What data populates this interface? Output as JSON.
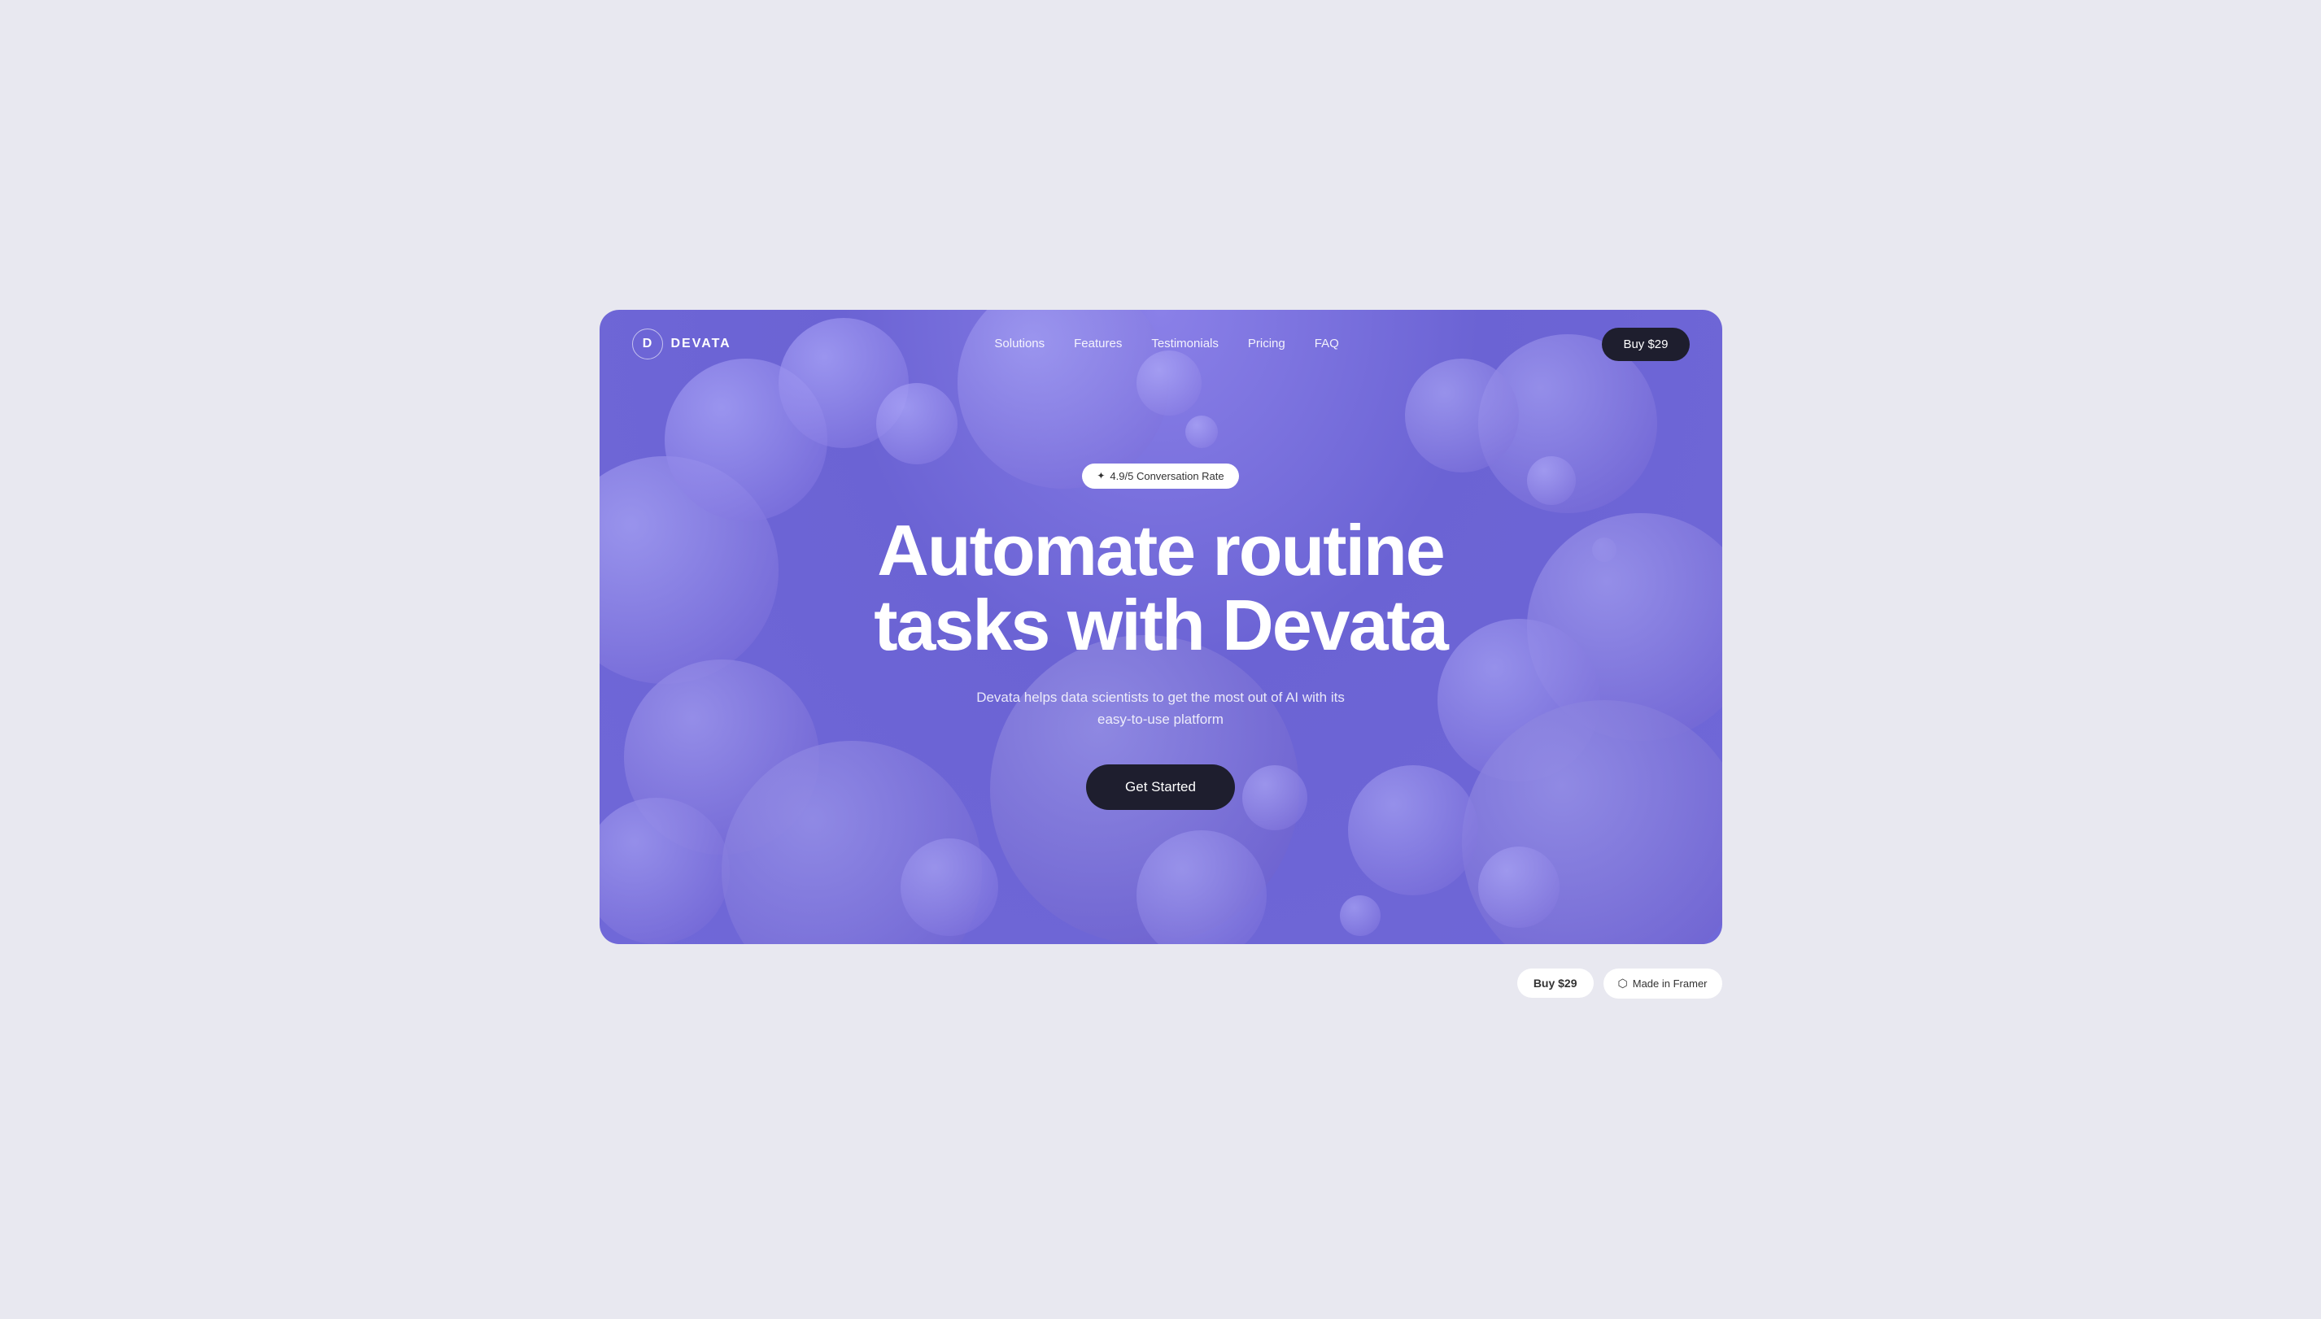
{
  "logo": {
    "letter": "D",
    "name": "DEVATA"
  },
  "nav": {
    "links": [
      {
        "label": "Solutions",
        "href": "#"
      },
      {
        "label": "Features",
        "href": "#"
      },
      {
        "label": "Testimonials",
        "href": "#"
      },
      {
        "label": "Pricing",
        "href": "#"
      },
      {
        "label": "FAQ",
        "href": "#"
      }
    ],
    "cta_label": "Buy $29"
  },
  "hero": {
    "badge_star": "✦",
    "badge_text": "4.9/5 Conversation Rate",
    "title_line1": "Automate routine",
    "title_line2": "tasks with Devata",
    "subtitle": "Devata helps data scientists to get the most out of AI with its easy-to-use platform",
    "cta_label": "Get Started"
  },
  "bottom": {
    "buy_label": "Buy $29",
    "framer_label": "Made in Framer"
  },
  "colors": {
    "hero_bg": "#7b72e0",
    "dark_btn": "#1e1e2e"
  }
}
